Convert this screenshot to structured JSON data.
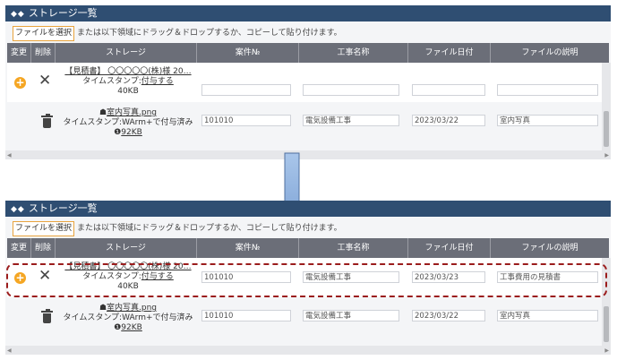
{
  "panels": [
    {
      "title": "ストレージ一覧",
      "select_button": "ファイルを選択",
      "drop_hint": "または以下領域にドラッグ＆ドロップするか、コピーして貼り付けます。",
      "headers": [
        "変更",
        "削除",
        "ストレージ",
        "案件№",
        "工事名称",
        "ファイル日付",
        "ファイルの説明"
      ],
      "row1": {
        "file_name": "【見積書】 〇〇〇〇〇(株)様 20…",
        "timestamp_label": "タイムスタンプ:",
        "timestamp_link": "付与する",
        "size": "40KB",
        "case_no": "",
        "project_name": "",
        "file_date": "",
        "description": ""
      },
      "row2": {
        "file_name": "室内写真.png",
        "timestamp_text": "タイムスタンプ:WArm+で付与済み",
        "size": "92KB",
        "case_no": "101010",
        "project_name": "電気設備工事",
        "file_date": "2023/03/22",
        "description": "室内写真"
      }
    },
    {
      "title": "ストレージ一覧",
      "select_button": "ファイルを選択",
      "drop_hint": "または以下領域にドラッグ＆ドロップするか、コピーして貼り付けます。",
      "headers": [
        "変更",
        "削除",
        "ストレージ",
        "案件№",
        "工事名称",
        "ファイル日付",
        "ファイルの説明"
      ],
      "row1": {
        "file_name": "【見積書】 〇〇〇〇〇(株)様 20…",
        "timestamp_label": "タイムスタンプ:",
        "timestamp_link": "付与する",
        "size": "40KB",
        "case_no": "101010",
        "project_name": "電気設備工事",
        "file_date": "2023/03/23",
        "description": "工事費用の見積書"
      },
      "row2": {
        "file_name": "室内写真.png",
        "timestamp_text": "タイムスタンプ:WArm+で付与済み",
        "size": "92KB",
        "case_no": "101010",
        "project_name": "電気設備工事",
        "file_date": "2023/03/22",
        "description": "室内写真"
      }
    }
  ],
  "colors": {
    "titlebar": "#2f4e72",
    "header": "#6b6e78",
    "accent": "#f5a623",
    "highlight": "#9b1c1c",
    "arrow": "#7fa7d6"
  },
  "icons": [
    "diamond-icon",
    "add-circle-icon",
    "close-icon",
    "trash-icon",
    "image-icon",
    "info-icon",
    "down-arrow-icon"
  ]
}
